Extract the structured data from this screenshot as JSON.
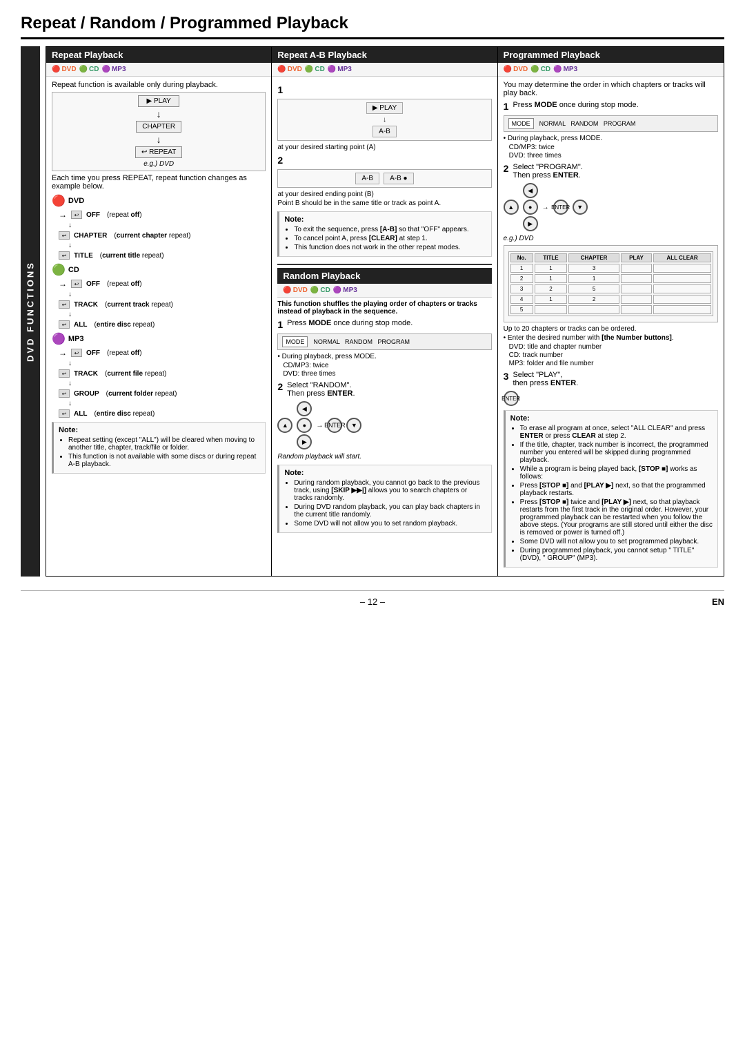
{
  "page": {
    "title": "Repeat / Random / Programmed Playback",
    "footer_page": "– 12 –",
    "footer_lang": "EN",
    "dvd_sidebar": "DVD FUNCTIONS"
  },
  "col1": {
    "header": "Repeat Playback",
    "formats": [
      "DVD",
      "CD",
      "MP3"
    ],
    "intro": "Repeat function is available only during playback.",
    "diagram_label": "e.g.) DVD",
    "step1_label": "PLAY",
    "step2_label": "CHAPTER",
    "step3_label": "REPEAT",
    "each_time": "Each time you press REPEAT, repeat function changes as example below.",
    "dvd_section": "DVD",
    "cd_section": "CD",
    "mp3_section": "MP3",
    "dvd_items": [
      {
        "icon": "↩",
        "label": "OFF",
        "desc": "(repeat off)"
      },
      {
        "icon": "↩",
        "label": "CHAPTER",
        "desc": "(current chapter repeat)"
      },
      {
        "icon": "↩",
        "label": "TITLE",
        "desc": "(current title repeat)"
      }
    ],
    "cd_items": [
      {
        "icon": "↩",
        "label": "OFF",
        "desc": "(repeat off)"
      },
      {
        "icon": "↩",
        "label": "TRACK",
        "desc": "(current track repeat)"
      },
      {
        "icon": "↩",
        "label": "ALL",
        "desc": "(entire disc repeat)"
      }
    ],
    "mp3_items": [
      {
        "icon": "↩",
        "label": "OFF",
        "desc": "(repeat off)"
      },
      {
        "icon": "↩",
        "label": "TRACK",
        "desc": "(current file repeat)"
      },
      {
        "icon": "↩",
        "label": "GROUP",
        "desc": "(current folder repeat)"
      },
      {
        "icon": "↩",
        "label": "ALL",
        "desc": "(entire disc repeat)"
      }
    ],
    "note_title": "Note:",
    "note_items": [
      "Repeat setting (except \"ALL\") will be cleared when moving to another title, chapter, track/file or folder.",
      "This function is not available with some discs or during repeat A-B playback."
    ]
  },
  "col2": {
    "header": "Repeat A-B Playback",
    "formats": [
      "DVD",
      "CD",
      "MP3"
    ],
    "step1": {
      "num": "1",
      "desc": "at your desired starting point (A)"
    },
    "step2": {
      "num": "2",
      "desc": "at your desired ending point (B)",
      "sub": "Point B should be in the same title or track as point A."
    },
    "note_title": "Note:",
    "note_items": [
      "To exit the sequence, press [A-B] so that \"OFF\" appears.",
      "To cancel point A, press [CLEAR] at step 1.",
      "This function does not work in the other repeat modes."
    ],
    "random_header": "Random Playback",
    "random_formats": [
      "DVD",
      "CD",
      "MP3"
    ],
    "random_intro": "This function shuffles the playing order of chapters or tracks instead of playback in the sequence.",
    "random_step1": {
      "num": "1",
      "desc": "Press MODE once during stop mode."
    },
    "random_step2": {
      "num": "2",
      "desc": "Select \"RANDOM\".",
      "sub": "Then press ENTER."
    },
    "random_mode_labels": [
      "NORMAL",
      "RANDOM",
      "PROGRAM"
    ],
    "random_during_note": "During playback, press MODE.",
    "random_cd_mp3": "CD/MP3: twice",
    "random_dvd": "DVD:    three times",
    "random_will_start": "Random playback will start.",
    "random_note_title": "Note:",
    "random_note_items": [
      "During random playback, you cannot go back to the previous track, using [SKIP ▶▶|] allows you to search chapters or tracks randomly.",
      "During DVD random playback, you can play back chapters in the current title randomly.",
      "Some DVD will not allow you to set random playback."
    ]
  },
  "col3": {
    "header": "Programmed Playback",
    "formats": [
      "DVD",
      "CD",
      "MP3"
    ],
    "intro": "You may determine the order in which chapters or tracks will play back.",
    "step1": {
      "num": "1",
      "desc": "Press MODE once during stop mode."
    },
    "step1_during": "During playback, press MODE.",
    "step1_cd_mp3": "CD/MP3: twice",
    "step1_dvd": "DVD:    three times",
    "step2": {
      "num": "2",
      "desc": "Select \"PROGRAM\".",
      "sub": "Then press ENTER."
    },
    "step2_example": "e.g.) DVD",
    "step2_note": "Up to 20 chapters or tracks can be ordered.",
    "step2_enter": "Enter the desired number with [the Number buttons].",
    "step2_dvd": "DVD: title and chapter number",
    "step2_cd": "CD:  track number",
    "step2_mp3": "MP3: folder and file number",
    "step3": {
      "num": "3",
      "desc": "Select \"PLAY\",",
      "sub": "then press ENTER."
    },
    "mode_labels": [
      "NORMAL",
      "RANDOM",
      "PROGRAM"
    ],
    "note_title": "Note:",
    "note_items": [
      "To erase all program at once, select \"ALL CLEAR\" and press ENTER or press CLEAR at step 2.",
      "If the title, chapter, track number is incorrect, the programmed number you entered will be skipped during programmed playback.",
      "While a program is being played back, [STOP ■] works as follows:",
      "Press [STOP ■] and [PLAY ▶] next, so that the programmed playback restarts.",
      "Press [STOP ■] twice and [PLAY ▶] next, so that playback restarts from the first track in the original order. However, your programmed playback can be restarted when you follow the above steps. (Your programs are still stored until either the disc is removed or power is turned off.)",
      "Some DVD will not allow you to set programmed playback.",
      "During programmed playback, you cannot setup \" TITLE\" (DVD), \" GROUP\" (MP3)."
    ]
  }
}
